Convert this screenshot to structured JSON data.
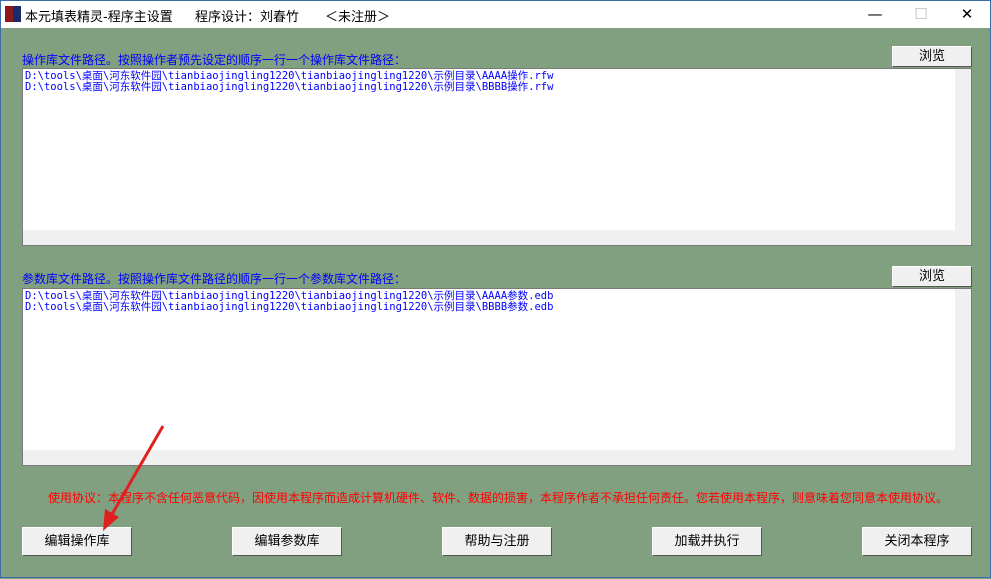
{
  "window": {
    "title": "本元填表精灵-程序主设置",
    "designer": "程序设计：刘春竹",
    "registration": "＜未注册＞"
  },
  "operation": {
    "label": "操作库文件路径。按照操作者预先设定的顺序一行一个操作库文件路径：",
    "browse": "浏览",
    "lines": [
      "D:\\tools\\桌面\\河东软件园\\tianbiaojingling1220\\tianbiaojingling1220\\示例目录\\AAAA操作.rfw",
      "D:\\tools\\桌面\\河东软件园\\tianbiaojingling1220\\tianbiaojingling1220\\示例目录\\BBBB操作.rfw"
    ]
  },
  "parameter": {
    "label": "参数库文件路径。按照操作库文件路径的顺序一行一个参数库文件路径：",
    "browse": "浏览",
    "lines": [
      "D:\\tools\\桌面\\河东软件园\\tianbiaojingling1220\\tianbiaojingling1220\\示例目录\\AAAA参数.edb",
      "D:\\tools\\桌面\\河东软件园\\tianbiaojingling1220\\tianbiaojingling1220\\示例目录\\BBBB参数.edb"
    ]
  },
  "notice": "使用协议：本程序不含任何恶意代码，因使用本程序而造成计算机硬件、软件、数据的损害，本程序作者不承担任何责任。您若使用本程序，则意味着您同意本使用协议。",
  "buttons": [
    "编辑操作库",
    "编辑参数库",
    "帮助与注册",
    "加载并执行",
    "关闭本程序"
  ],
  "colors": {
    "background": "#80a080",
    "label": "#0000ff",
    "notice": "#ff0000",
    "annotation_arrow": "#e02020"
  }
}
